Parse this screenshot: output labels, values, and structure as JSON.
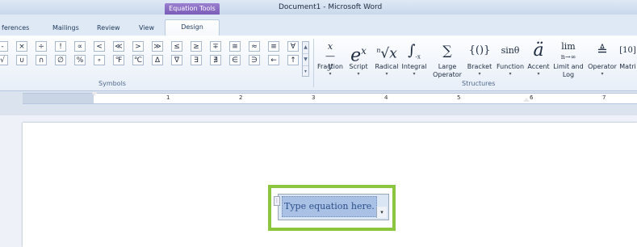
{
  "window": {
    "title": "Document1 - Microsoft Word",
    "context_tab": "Equation Tools"
  },
  "tabs": [
    "ferences",
    "Mailings",
    "Review",
    "View",
    "Design"
  ],
  "symbols": {
    "group_label": "Symbols",
    "row1": [
      "-",
      "×",
      "÷",
      "!",
      "∝",
      "<",
      "≪",
      ">",
      "≫",
      "≤",
      "≥",
      "∓",
      "≅",
      "≈",
      "≡",
      "∀"
    ],
    "row2": [
      "√",
      "∪",
      "∩",
      "∅",
      "%",
      "∘",
      "℉",
      "℃",
      "∆",
      "∇",
      "∃",
      "∄",
      "∈",
      "∋",
      "←",
      "↑"
    ]
  },
  "structures": {
    "group_label": "Structures",
    "items": [
      {
        "glyph": "x⁄y",
        "label": "Fraction"
      },
      {
        "glyph": "eˣ",
        "label": "Script"
      },
      {
        "glyph": "ⁿ√x",
        "label": "Radical"
      },
      {
        "glyph": "∫",
        "label": "Integral"
      },
      {
        "glyph": "∑",
        "label": "Large Operator"
      },
      {
        "glyph": "{()}",
        "label": "Bracket"
      },
      {
        "glyph": "sinθ",
        "label": "Function"
      },
      {
        "glyph": "ä",
        "label": "Accent"
      },
      {
        "glyph": "lim",
        "label": "Limit and Log"
      },
      {
        "glyph": "≜",
        "label": "Operator"
      },
      {
        "glyph": "[10]",
        "label": "Matri"
      }
    ]
  },
  "ruler": {
    "numbers": [
      "1",
      "2",
      "3",
      "4",
      "5",
      "6",
      "7"
    ]
  },
  "equation": {
    "placeholder": "Type equation here."
  }
}
